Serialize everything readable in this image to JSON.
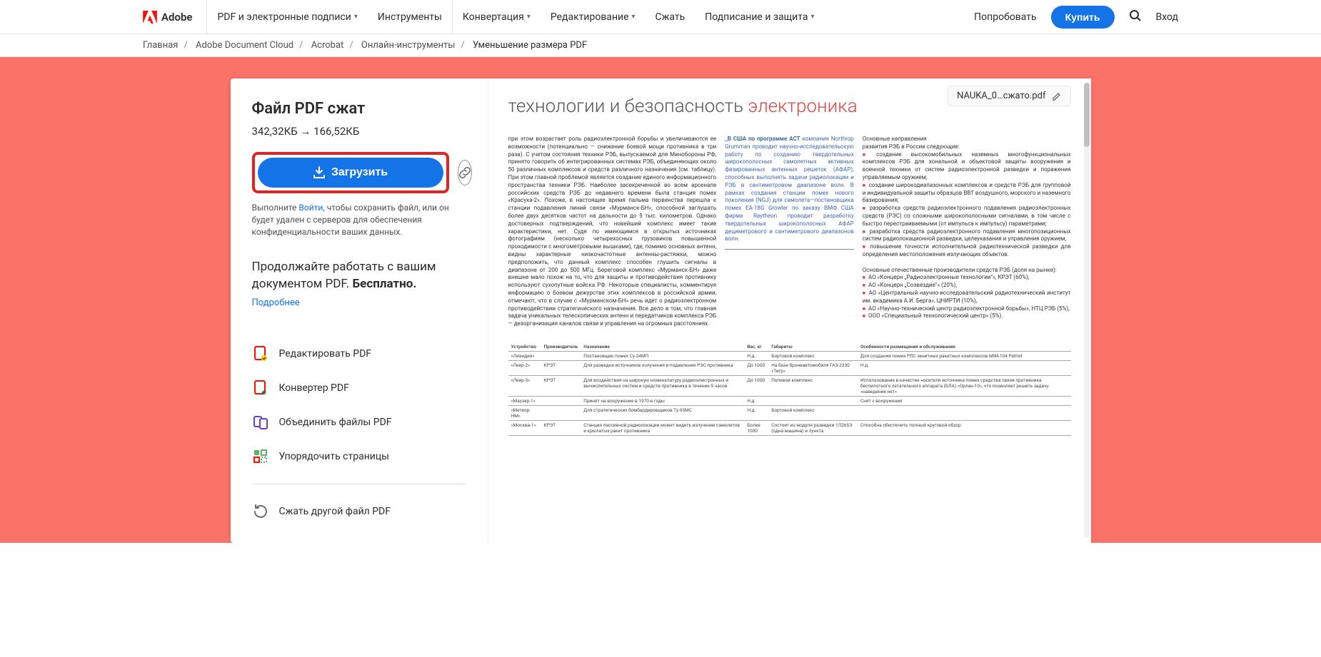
{
  "header": {
    "brand": "Adobe",
    "nav": [
      {
        "label": "PDF и электронные подписи",
        "chev": true
      },
      {
        "label": "Инструменты",
        "chev": false
      },
      {
        "label": "Конвертация",
        "chev": true
      },
      {
        "label": "Редактирование",
        "chev": true
      },
      {
        "label": "Сжать",
        "chev": false
      },
      {
        "label": "Подписание и защита",
        "chev": true
      }
    ],
    "try": "Попробовать",
    "buy": "Купить",
    "login": "Вход"
  },
  "breadcrumb": {
    "items": [
      "Главная",
      "Adobe Document Cloud",
      "Acrobat",
      "Онлайн-инструменты"
    ],
    "current": "Уменьшение размера PDF"
  },
  "panel": {
    "title": "Файл PDF сжат",
    "size_from": "342,32КБ",
    "size_arrow": "→",
    "size_to": "166,52КБ",
    "download": "Загрузить",
    "note_before": "Выполните ",
    "note_signin": "Войти",
    "note_after": ", чтобы сохранить файл, или он будет удален с серверов для обеспечения конфиденциальности ваших данных.",
    "keep1": "Продолжайте работать с вашим документом PDF. ",
    "keep2": "Бесплатно.",
    "learn": "Подробнее",
    "tools": [
      {
        "label": "Редактировать PDF"
      },
      {
        "label": "Конвертер PDF"
      },
      {
        "label": "Объединить файлы PDF"
      },
      {
        "label": "Упорядочить страницы"
      }
    ],
    "compress_again": "Сжать другой файл PDF"
  },
  "doc": {
    "filename": "NAUKA_0…сжато.pdf",
    "heading_a": "технологии и безопасность ",
    "heading_b": "электроника",
    "col1": "при этом возрастает роль радиоэлектронной борьбы и увеличиваются ее возможности (потенциально — снижение боевой мощи противника в три раза). С учетом состояния техники РЭБ, выпускаемой для Минобороны РФ, принято говорить об интегрированных системах РЭБ, объединяющих около 50 различных комплексов и средств различного назначения (см. таблицу). При этом главной проблемой является создание единого информационного пространства техники РЭБ. Наиболее засекреченной во всем арсенале российских средств РЭБ до недавнего времени была станция помех «Красуха-2». Похоже, в настоящее время пальма первенства перешла к станции подавления линий связи «Мурманск-БН», способной заглушать более двух десятков частот на дальности до 5 тыс. километров. Однако достоверных подтверждений, что новейший комплекс имеет такие характеристики, нет. Судя по имеющимся в открытых источниках фотографиям (несколько четырехосных грузовиков повышенной проходимости с многометровыми вышками), где, помимо основных антенн, видны характерные низкочастотные антенны-растяжки, можно предположить, что данный комплекс способен глушить сигналы в диапазоне от 200 до 500 МГц. Береговой комплекс «Мурманск-БН» даже внешне мало похож на то, что для защиты и противодействия противнику используют сухопутные войска РФ. Некоторые специалисты, комментируя информацию о боевом дежурстве этих комплексов в российской армии, отмечают, что в случае с «Мурманском-БН» речь идет о радиоэлектронном противодействии стратегического назначения. Все дело в том, что главная задача уникальных телескопических антенн и передатчиков комплекса РЭБ — дезорганизация каналов связи и управления на огромных расстояниях.",
    "col2_lead": "_В США по программе ACT",
    "col2": " компания Northrop Grumman проводит научно-исследовательскую работу по созданию твердотельных широкополосных самолетных активных фазированных антенных решеток (АФАР), способных выполнять задачи радиолокации и РЭБ в сантиметровом диапазоне волн. В рамках создания станции помех нового поколения (NGJ) для самолета—постановщика помех EA-18G Growler по заказу ВМФ США фирма Raytheon проводит разработку твердотельных широкополосных АФАР дециметрового и сантиметрового диапазонов волн.",
    "col3_hd1": "Основные направления",
    "col3_hd2": "развития РЭБ в России следующие:",
    "col3_items": [
      "создание высокомобильных наземных многофункциональных комплексов РЭБ для зональной и объектовой защиты вооружения и военной техники от систем радиоэлектронной разведки и поражения управляемым оружием;",
      "создание широкодиапазонных комплексов и средств РЭБ для групповой и индивидуальной защиты образцов ВВТ воздушного, морского и наземного базирования;",
      "разработка средств радиоэлектронного подавления радиоэлектронных средств (РЭС) со сложными широкополосными сигналами, в том числе с быстро перестраиваемыми (от импульса к импульсу) параметрами;",
      "разработка средств радиоэлектронного подавления многопозиционных систем радиолокационной разведки, целеуказания и управления оружием;",
      "повышение точности исполнительной радиотехнической разведки для определения местоположения излучающих объектов."
    ],
    "col3_hd3": "Основные отечественные производители средств РЭБ (доля на рынке):",
    "col3_items2": [
      "АО «Концерн „Радиоэлектронные технологии\"», КРЭТ (60%),",
      "АО «Концерн „Созвездие\"» (20%),",
      "АО «Центральный научно-исследовательский радиотехнический институт им. академика А.И. Берга», ЦНИРТИ (10%),",
      "АО «Научно-технический центр радиоэлектронной борьбы», НТЦ РЭБ (5%),",
      "ООО «Специальный технологический центр» (5%)."
    ],
    "table": {
      "headers": [
        "Устройство",
        "Производитель",
        "Назначение",
        "Вес, кг",
        "Габариты",
        "Особенности размещения и обслуживания"
      ],
      "rows": [
        [
          "«Лиандия»",
          "",
          "Постановщик помех Су-24МП",
          "Н.д.",
          "Бортовой комплекс",
          "Для создания помех РЛС зенитных ракетных комплексов MIM-104 Patriot"
        ],
        [
          "«Леер-2»",
          "КРЭТ",
          "Для разведки источников излучения и подавления РЭС противника",
          "До 1000",
          "На базе бронеавтомобиля ГАЗ-2330 «Тигр»",
          "Н.д."
        ],
        [
          "«Леер-3»",
          "КРЭТ",
          "Для воздействия на широкую номенклатуру радиоэлектронных и вычислительных систем и средств противника в течение 9 часов",
          "До 1000",
          "Полевой комплекс",
          "Использование в качестве носителя источника помех средства связи противника беспилотного летательного аппарата (БЛА) «Орлан-10», что позволяет решить задачу «наведения нет»"
        ],
        [
          "«Маузер-1»",
          "",
          "Принят на вооружение в 1970-е годы",
          "Н.д.",
          "",
          "Снят с вооружения"
        ],
        [
          "«Метеор-НМ»",
          "",
          "Для стратегических бомбардировщиков Ту-95МС",
          "Н.д.",
          "Бортовой комплекс",
          ""
        ],
        [
          "«Москва-1»",
          "КРЭТ",
          "Станция пассивной радиолокации может видеть излучение самолетов и крылатых ракет противника",
          "Более 1000",
          "Состоит из модуля разведки 1Л265Э (одна машина) и пункта",
          "Способна обеспечить полный круговой обзор"
        ]
      ]
    }
  }
}
